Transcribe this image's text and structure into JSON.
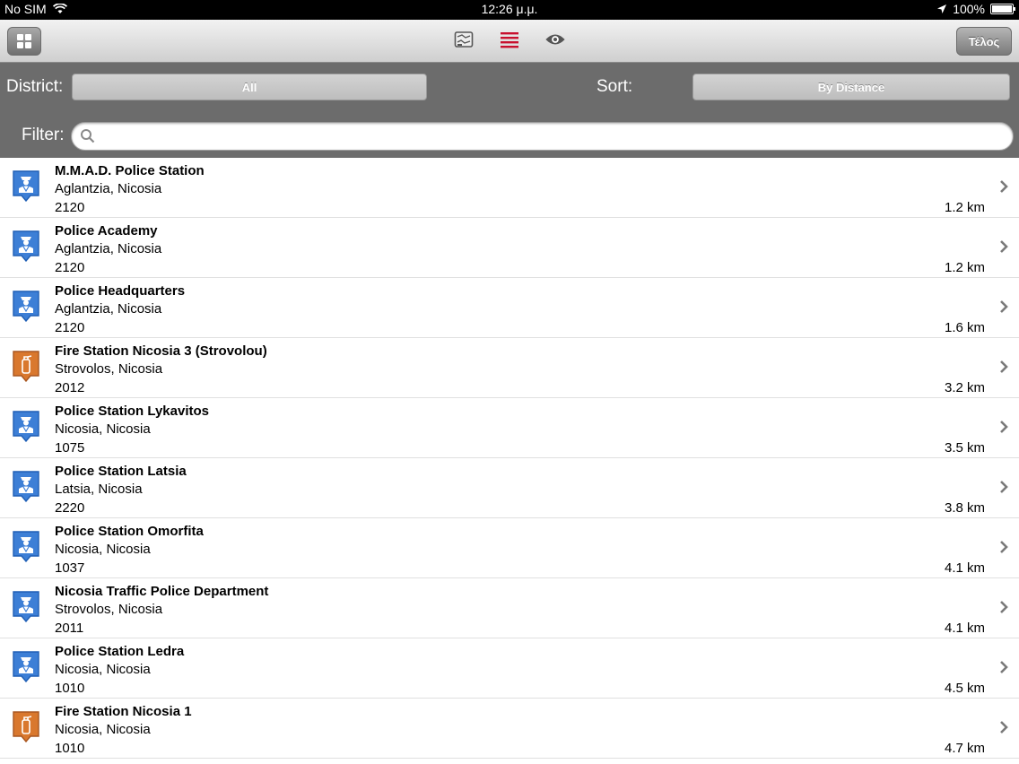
{
  "status_bar": {
    "carrier": "No SIM",
    "time": "12:26 μ.μ.",
    "battery": "100%",
    "battery_level": 1.0
  },
  "toolbar": {
    "done_label": "Τέλος"
  },
  "filters": {
    "district_label": "District:",
    "district_value": "All",
    "sort_label": "Sort:",
    "sort_value": "By Distance",
    "filter_label": "Filter:",
    "filter_value": ""
  },
  "colors": {
    "police": "#3d7fd6",
    "fire": "#d9782e",
    "active_view": "#c8102e"
  },
  "stations": [
    {
      "name": "M.M.A.D. Police Station",
      "address": "Aglantzia, Nicosia",
      "zip": "2120",
      "distance": "1.2 km",
      "kind": "police-icon"
    },
    {
      "name": "Police Academy",
      "address": "Aglantzia, Nicosia",
      "zip": "2120",
      "distance": "1.2 km",
      "kind": "police-icon"
    },
    {
      "name": "Police Headquarters",
      "address": "Aglantzia, Nicosia",
      "zip": "2120",
      "distance": "1.6 km",
      "kind": "police-icon"
    },
    {
      "name": "Fire Station Nicosia 3 (Strovolou)",
      "address": "Strovolos, Nicosia",
      "zip": "2012",
      "distance": "3.2 km",
      "kind": "fire-extinguisher-icon"
    },
    {
      "name": "Police Station Lykavitos",
      "address": "Nicosia, Nicosia",
      "zip": "1075",
      "distance": "3.5 km",
      "kind": "police-icon"
    },
    {
      "name": "Police Station Latsia",
      "address": "Latsia, Nicosia",
      "zip": "2220",
      "distance": "3.8 km",
      "kind": "police-icon"
    },
    {
      "name": "Police Station Omorfita",
      "address": "Nicosia, Nicosia",
      "zip": "1037",
      "distance": "4.1 km",
      "kind": "police-icon"
    },
    {
      "name": "Nicosia Traffic Police Department",
      "address": "Strovolos, Nicosia",
      "zip": "2011",
      "distance": "4.1 km",
      "kind": "police-icon"
    },
    {
      "name": "Police Station Ledra",
      "address": "Nicosia, Nicosia",
      "zip": "1010",
      "distance": "4.5 km",
      "kind": "police-icon"
    },
    {
      "name": "Fire Station Nicosia 1",
      "address": "Nicosia, Nicosia",
      "zip": "1010",
      "distance": "4.7 km",
      "kind": "fire-extinguisher-icon"
    }
  ]
}
